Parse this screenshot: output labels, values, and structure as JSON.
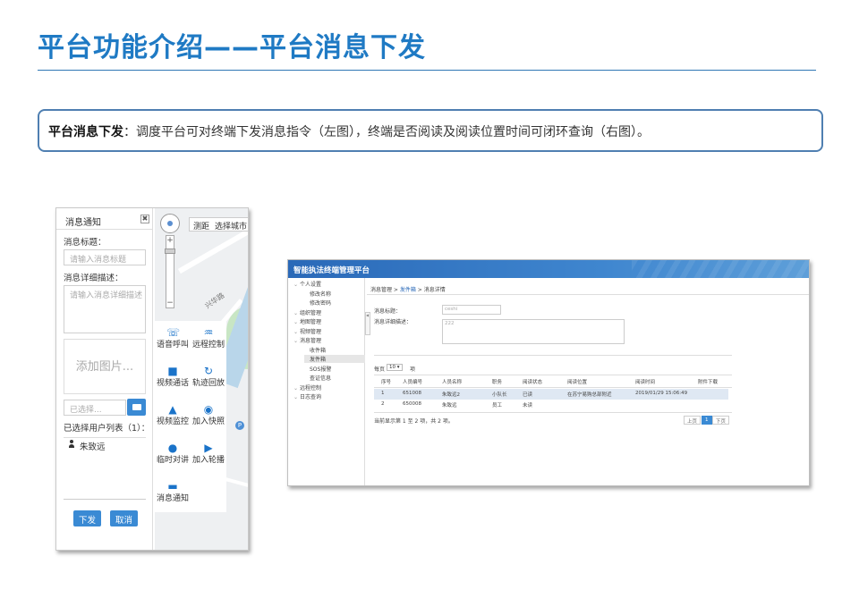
{
  "slide": {
    "title": "平台功能介绍——平台消息下发",
    "desc_bold": "平台消息下发",
    "desc_text": "：调度平台可对终端下发消息指令（左图），终端是否阅读及阅读位置时间可闭环查询（右图）。"
  },
  "left": {
    "panel_title": "消息通知",
    "close_glyph": "✖",
    "title_label": "消息标题：",
    "title_placeholder": "请输入消息标题",
    "detail_label": "消息详细描述：",
    "detail_placeholder": "请输入消息详细描述",
    "add_image": "添加图片...",
    "choose_placeholder": "已选择...",
    "selected_users_label": "已选择用户列表（1）：",
    "user_name": "朱致远",
    "send_button": "下发",
    "cancel_button": "取消",
    "map_toolbar": [
      "测距",
      "选择城市"
    ],
    "map_road_label": "兴华路",
    "map_pin": "P",
    "functions": [
      {
        "icon": "☏",
        "label": "语音呼叫"
      },
      {
        "icon": "♒",
        "label": "远程控制"
      },
      {
        "icon": "■",
        "label": "视频通话"
      },
      {
        "icon": "↻",
        "label": "轨迹回放"
      },
      {
        "icon": "▲",
        "label": "视频监控"
      },
      {
        "icon": "◉",
        "label": "加入快照"
      },
      {
        "icon": "●",
        "label": "临时对讲"
      },
      {
        "icon": "▶",
        "label": "加入轮播"
      },
      {
        "icon": "▬",
        "label": "消息通知"
      }
    ]
  },
  "right": {
    "app_title": "智能执法终端管理平台",
    "sidebar": [
      {
        "label": "个人设置",
        "level": "top"
      },
      {
        "label": "修改名称",
        "level": "sub"
      },
      {
        "label": "修改密码",
        "level": "sub"
      },
      {
        "label": "组织管理",
        "level": "top"
      },
      {
        "label": "地图管理",
        "level": "top"
      },
      {
        "label": "视频管理",
        "level": "top"
      },
      {
        "label": "消息管理",
        "level": "top"
      },
      {
        "label": "收件箱",
        "level": "sub"
      },
      {
        "label": "发件箱",
        "level": "active"
      },
      {
        "label": "SOS报警",
        "level": "sub"
      },
      {
        "label": "查证信息",
        "level": "sub"
      },
      {
        "label": "远程控制",
        "level": "top"
      },
      {
        "label": "日志查询",
        "level": "top"
      }
    ],
    "breadcrumb": {
      "part1": "消息管理 > ",
      "link": "发件箱",
      "part2": " > 消息详情"
    },
    "form": {
      "title_label": "消息标题：",
      "title_value": "ceshi",
      "detail_label": "消息详细描述：",
      "detail_value": "222"
    },
    "page_size": {
      "prefix": "每页",
      "value": "10",
      "suffix": "项"
    },
    "columns": [
      "序号",
      "人员编号",
      "人员名称",
      "职务",
      "阅读状态",
      "阅读位置",
      "阅读时间",
      "附件下载"
    ],
    "rows": [
      [
        "1",
        "651008",
        "朱致远2",
        "小队长",
        "已读",
        "在苏宁易购总部附近",
        "2019/01/29 15:06:49",
        ""
      ],
      [
        "2",
        "650008",
        "朱致远",
        "员工",
        "未读",
        "",
        "",
        ""
      ]
    ],
    "summary": "当前显示第 1 至 2 项，共 2 项。",
    "pager": {
      "prev": "上页",
      "current": "1",
      "next": "下页"
    }
  }
}
